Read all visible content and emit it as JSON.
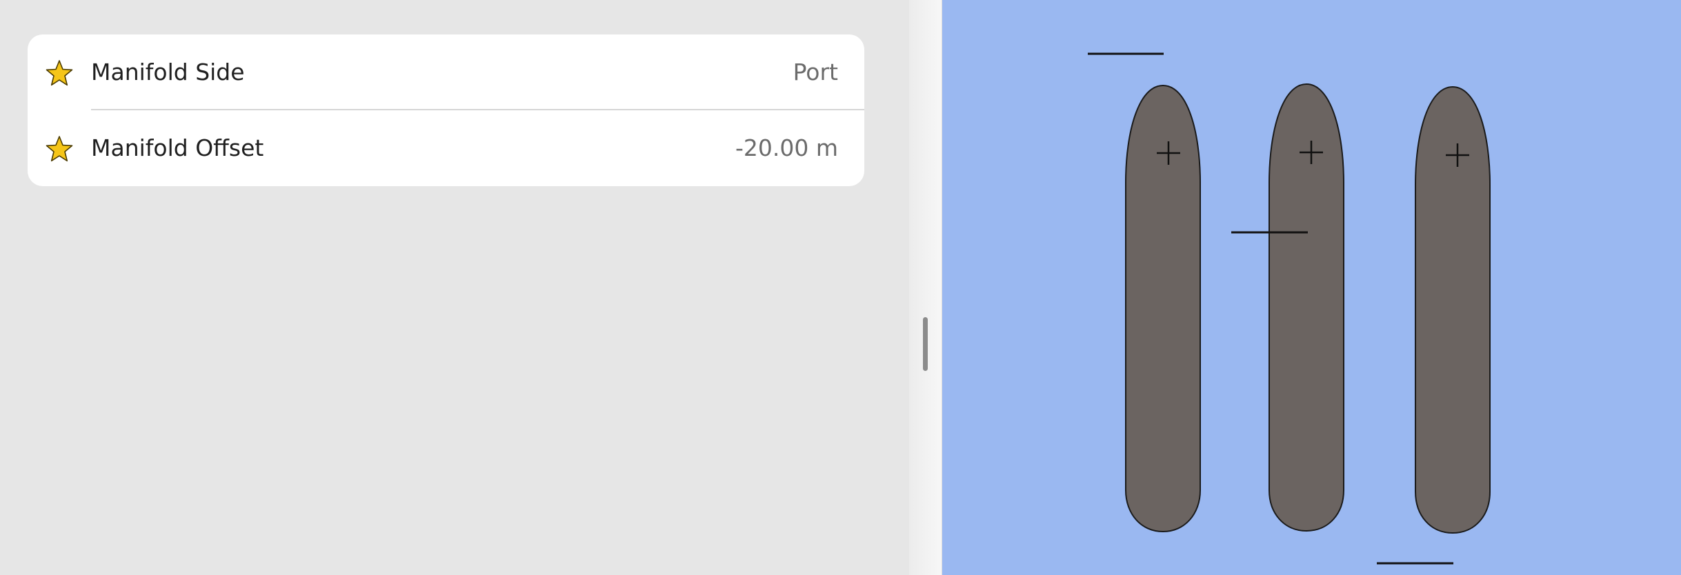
{
  "settings": {
    "rows": [
      {
        "icon": "star-icon",
        "label": "Manifold Side",
        "value": "Port"
      },
      {
        "icon": "star-icon",
        "label": "Manifold Offset",
        "value": "-20.00 m"
      }
    ]
  },
  "map": {
    "water_color": "#9ab8f1",
    "vessel_color": "#6b6461",
    "star_color": "#f5c518",
    "vessel_count": 3
  }
}
